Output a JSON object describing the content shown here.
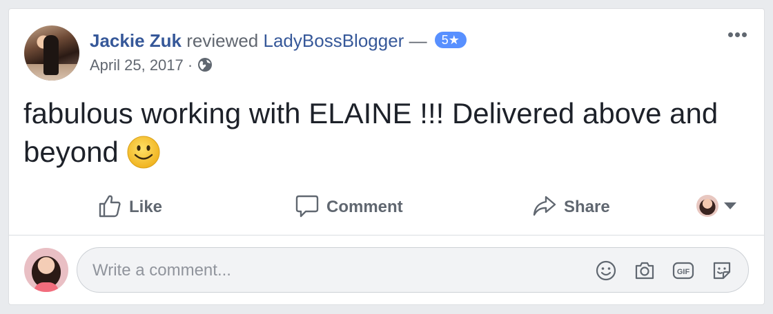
{
  "review": {
    "author_name": "Jackie Zuk",
    "action_text": "reviewed",
    "page_name": "LadyBossBlogger",
    "dash": "—",
    "rating": "5★",
    "date": "April 25, 2017",
    "date_sep": "·",
    "body_text": "fabulous working with ELAINE !!! Delivered above and beyond"
  },
  "actions": {
    "like_label": "Like",
    "comment_label": "Comment",
    "share_label": "Share"
  },
  "comment_composer": {
    "placeholder": "Write a comment..."
  },
  "icons": {
    "visibility": "globe-icon",
    "menu": "more-icon",
    "emoji": "smile-emoji",
    "composer": [
      "emoji-icon",
      "camera-icon",
      "gif-icon",
      "sticker-icon"
    ]
  },
  "colors": {
    "link": "#365899",
    "badge": "#5890ff",
    "muted": "#606770",
    "emoji": "#f5c33b"
  }
}
